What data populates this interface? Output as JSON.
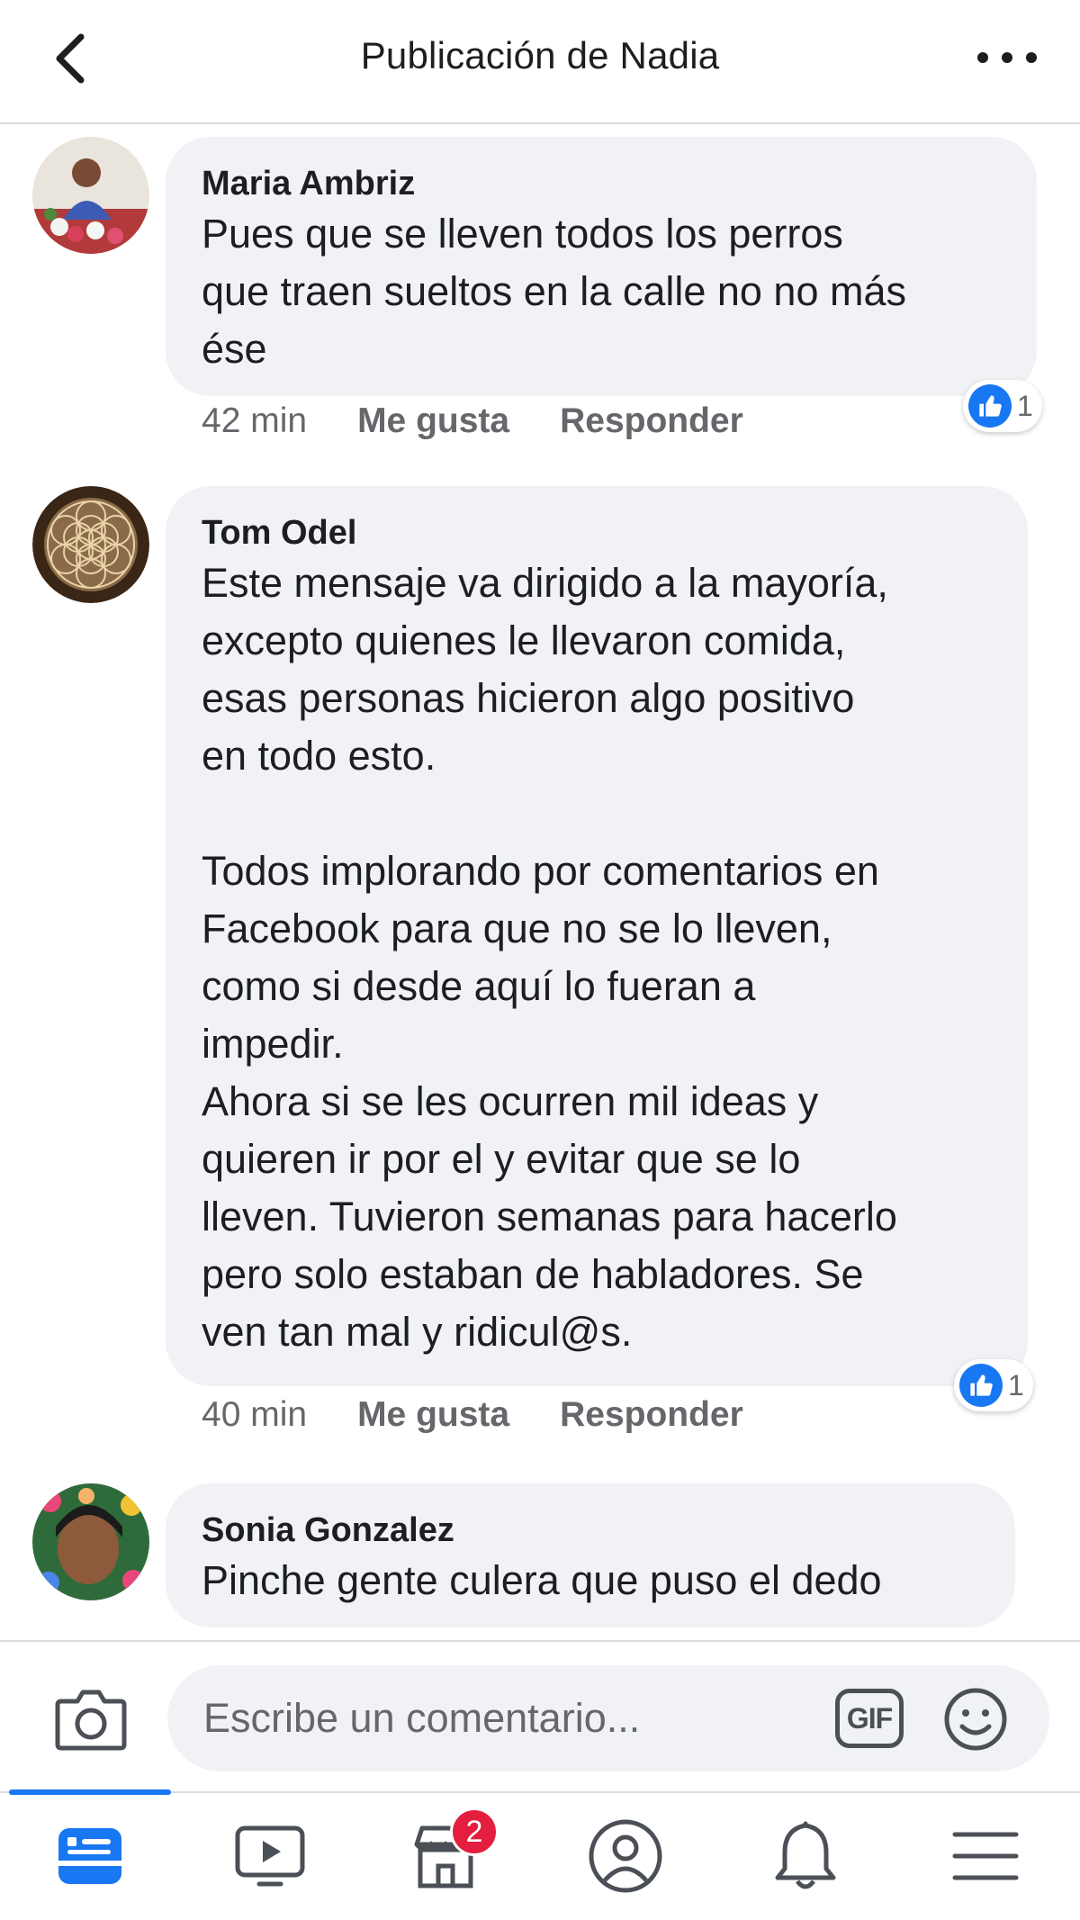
{
  "header": {
    "title": "Publicación de Nadia"
  },
  "comments": [
    {
      "author": "Maria Ambriz",
      "text": "Pues que se lleven todos los perros\nque traen sueltos en la calle no no más\nése",
      "time": "42 min",
      "like_label": "Me gusta",
      "reply_label": "Responder",
      "reaction_count": "1"
    },
    {
      "author": "Tom Odel",
      "text": "Este mensaje va dirigido a la mayoría,\nexcepto quienes le llevaron comida,\nesas personas hicieron algo positivo\nen todo esto.\n\nTodos implorando por comentarios en\nFacebook para que no se lo lleven,\ncomo si desde aquí lo fueran a\nimpedir.\nAhora si se les ocurren mil ideas y\nquieren ir por el y evitar que se lo\nlleven. Tuvieron semanas para hacerlo\npero solo estaban de habladores. Se\nven tan mal y ridicul@s.",
      "time": "40 min",
      "like_label": "Me gusta",
      "reply_label": "Responder",
      "reaction_count": "1"
    },
    {
      "author": "Sonia Gonzalez",
      "text": "Pinche gente culera que puso el dedo"
    }
  ],
  "composer": {
    "placeholder": "Escribe un comentario...",
    "gif_label": "GIF"
  },
  "bottom_nav": {
    "items": [
      "news-feed-icon",
      "watch-icon",
      "marketplace-icon",
      "profile-icon",
      "notifications-icon",
      "menu-icon"
    ],
    "marketplace_badge": "2"
  },
  "colors": {
    "accent": "#1877f2",
    "bubble": "#f0f2f5",
    "secondary_text": "#65676b",
    "badge": "#e41e3f"
  }
}
